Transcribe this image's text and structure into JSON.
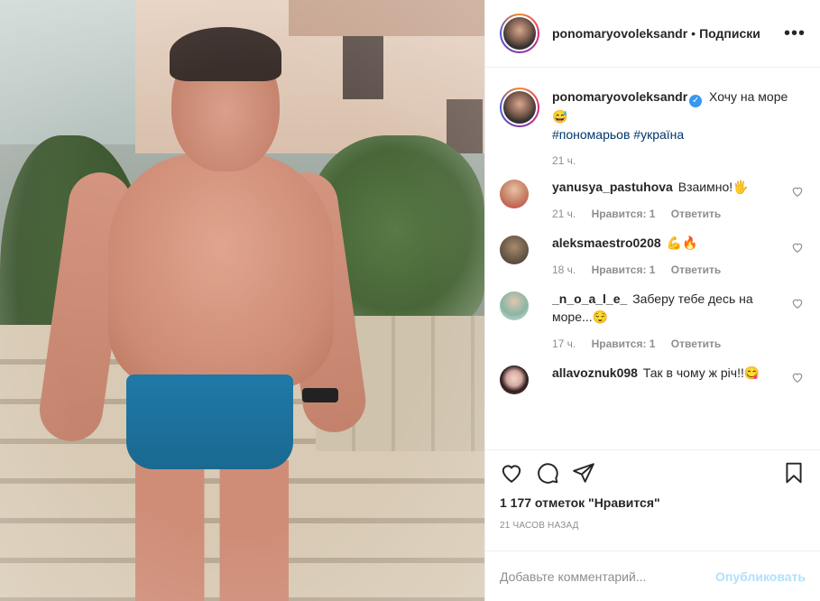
{
  "header": {
    "username": "ponomaryovoleksandr",
    "separator": "•",
    "follow_label": "Подписки",
    "more_label": "•••"
  },
  "caption": {
    "username": "ponomaryovoleksandr",
    "verified_glyph": "✓",
    "text": "Хочу на море 😅",
    "hashtags": [
      "#пономарьов",
      "#україна"
    ],
    "time": "21 ч."
  },
  "comments": [
    {
      "username": "yanusya_pastuhova",
      "text": "Взаимно!🖐",
      "time": "21 ч.",
      "likes": "Нравится: 1",
      "reply": "Ответить",
      "avatar_color": "#c98a6e"
    },
    {
      "username": "aleksmaestro0208",
      "text": "💪🔥",
      "time": "18 ч.",
      "likes": "Нравится: 1",
      "reply": "Ответить",
      "avatar_color": "#6b5a48"
    },
    {
      "username": "_n_o_a_l_e_",
      "text": "Заберу тебе десь на море...😌",
      "time": "17 ч.",
      "likes": "Нравится: 1",
      "reply": "Ответить",
      "avatar_color": "#8ab6a4"
    },
    {
      "username": "allavoznuk098",
      "text": "Так в чому ж річ!!😋",
      "time": "",
      "likes": "",
      "reply": "",
      "avatar_color": "#b23a3a"
    }
  ],
  "actions": {
    "like_icon": "heart-icon",
    "comment_icon": "comment-icon",
    "share_icon": "paper-plane-icon",
    "save_icon": "bookmark-icon"
  },
  "likes_count": "1 177 отметок \"Нравится\"",
  "time_ago": "21 часов назад",
  "add_comment": {
    "placeholder": "Добавьте комментарий...",
    "post_label": "Опубликовать"
  },
  "colors": {
    "text": "#262626",
    "muted": "#8e8e8e",
    "link": "#00376b",
    "verified": "#3897f0",
    "post_button_disabled": "#b2dffc"
  }
}
